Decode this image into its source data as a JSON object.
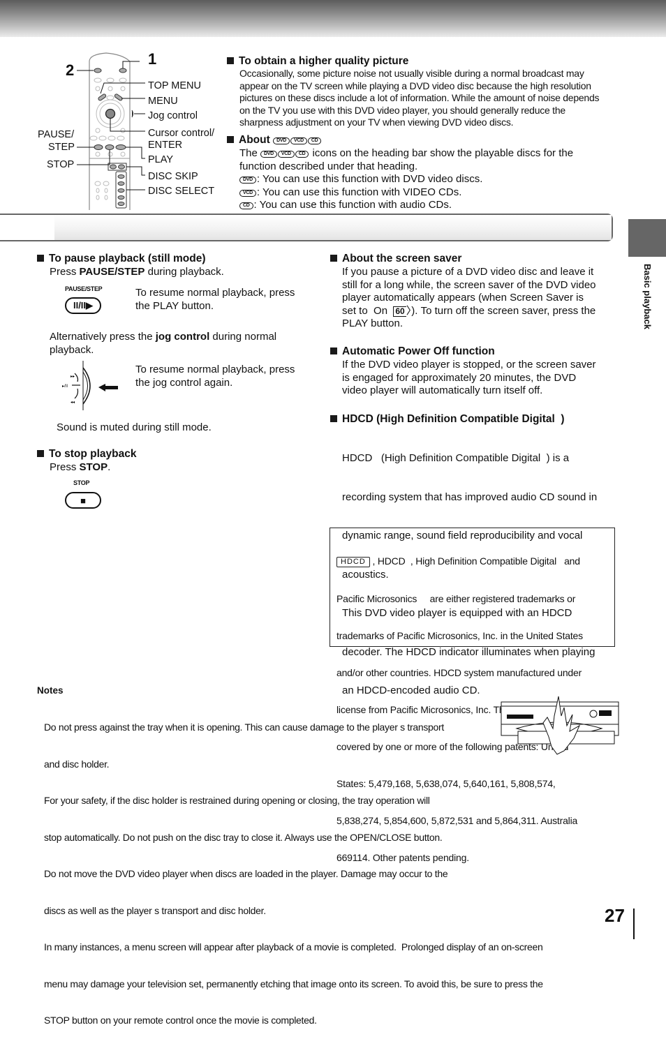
{
  "header": {
    "section_tab_label": "Basic playback",
    "page_number": "27"
  },
  "remote_diagram": {
    "callout_1": "1",
    "callout_2": "2",
    "labels": {
      "top_menu": "TOP MENU",
      "menu": "MENU",
      "jog_control": "Jog control",
      "cursor_control": "Cursor control/",
      "enter": "ENTER",
      "play": "PLAY",
      "disc_skip": "DISC SKIP",
      "disc_select": "DISC SELECT",
      "pause": "PAUSE/",
      "step": "STEP",
      "stop": "STOP"
    }
  },
  "higher_quality": {
    "title": "To obtain a higher quality picture",
    "lines": [
      "Occasionally, some picture noise not usually visible during a normal broadcast may",
      "appear on the TV screen while playing a DVD video disc because the high resolution",
      "pictures on these discs include a lot of information. While the amount of noise depends",
      "on the TV you use with this DVD video player, you should generally reduce the",
      "sharpness adjustment on your TV when viewing DVD video discs."
    ]
  },
  "about_icons": {
    "title": "About",
    "icons": {
      "dvd": "DVD",
      "vcd": "VCD",
      "cd": "CD"
    },
    "intro_prefix": "The",
    "intro_suffix": "icons on the heading bar show the playable discs for the",
    "intro_line2": "function described under that heading.",
    "dvd_desc": ": You can use this function with DVD video discs.",
    "vcd_desc": ": You can use this function with VIDEO CDs.",
    "cd_desc": ": You can use this function with audio CDs."
  },
  "pause_section": {
    "title": "To pause playback (still mode)",
    "press_prefix": "Press ",
    "press_bold": "PAUSE/STEP",
    "press_suffix": " during playback.",
    "button_caption": "PAUSE/STEP",
    "button_glyph": "II/II▶",
    "resume_play_l1": "To resume normal playback, press",
    "resume_play_l2": "the PLAY button.",
    "alt_prefix": "Alternatively press the ",
    "alt_bold": "jog control",
    "alt_suffix": " during normal",
    "alt_l2": "playback.",
    "resume_jog_l1": "To resume normal playback, press",
    "resume_jog_l2": "the jog control again.",
    "muted_note": "Sound is muted during still mode."
  },
  "stop_section": {
    "title": "To stop playback",
    "press_prefix": "Press ",
    "press_bold": "STOP",
    "press_suffix": ".",
    "button_caption": "STOP",
    "button_glyph": "■"
  },
  "screen_saver": {
    "title": "About the screen saver",
    "lines": [
      "If you pause a picture of a DVD video disc and leave it",
      "still for a long while, the screen saver of the DVD video",
      "player automatically appears (when  Screen Saver  is"
    ],
    "line4_prefix": "set to  On  ",
    "page_ref": "60",
    "line4_suffix": "). To turn off the screen saver, press the",
    "line5": "PLAY button."
  },
  "auto_power_off": {
    "title": "Automatic Power Off function",
    "lines": [
      "If the DVD video player is stopped, or the screen saver",
      "is engaged for approximately 20 minutes, the DVD",
      "video player will automatically turn itself off."
    ]
  },
  "hdcd": {
    "title": "HDCD (High Definition Compatible Digital  )",
    "lines": [
      "HDCD   (High Definition Compatible Digital  ) is a",
      "recording system that has improved audio CD sound in",
      "dynamic range, sound field reproducibility and vocal",
      "acoustics.",
      "This DVD video player is equipped with an HDCD",
      "decoder. The HDCD indicator illuminates when playing",
      "an HDCD-encoded audio CD."
    ]
  },
  "trademark_box": {
    "logo": "HDCD",
    "line1_suffix": " , HDCD  , High Definition Compatible Digital   and",
    "lines": [
      "Pacific Microsonics     are either registered trademarks or",
      "trademarks of Pacific Microsonics, Inc. in the United States",
      "and/or other countries. HDCD system manufactured under",
      "license from Pacific Microsonics, Inc. This product is",
      "covered by one or more of the following patents: United",
      "States: 5,479,168, 5,638,074, 5,640,161, 5,808,574,",
      "5,838,274, 5,854,600, 5,872,531 and 5,864,311. Australia",
      "669114. Other patents pending."
    ]
  },
  "notes": {
    "title": "Notes",
    "lines": [
      "Do not press against the tray when it is opening. This can cause damage to the player s transport",
      "and disc holder.",
      "For your safety, if the disc holder is restrained during opening or closing, the tray operation will",
      "stop automatically. Do not push on the disc tray to close it. Always use the OPEN/CLOSE button.",
      "Do not move the DVD video player when discs are loaded in the player. Damage may occur to the",
      "discs as well as the player s transport and disc holder.",
      "In many instances, a menu screen will appear after playback of a movie is completed.  Prolonged display of an on-screen",
      "menu may damage your television set, permanently etching that image onto its screen. To avoid this, be sure to press the",
      "STOP button on your remote control once the movie is completed."
    ]
  }
}
